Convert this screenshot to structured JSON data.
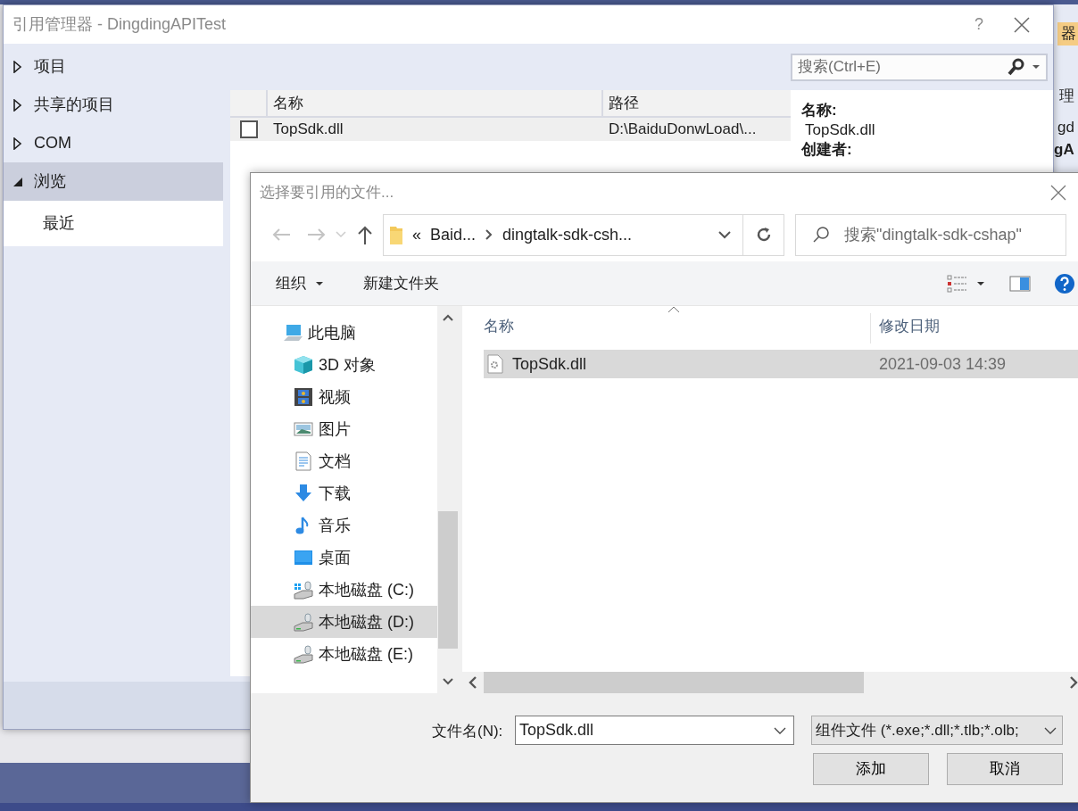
{
  "background_ide": {
    "fragments": [
      "器",
      "理",
      "gd",
      "gA"
    ]
  },
  "reference_manager": {
    "title": "引用管理器 - DingdingAPITest",
    "help": "?",
    "nav": [
      {
        "label": "项目",
        "expanded": false,
        "selected": false
      },
      {
        "label": "共享的项目",
        "expanded": false,
        "selected": false
      },
      {
        "label": "COM",
        "expanded": false,
        "selected": false
      },
      {
        "label": "浏览",
        "expanded": true,
        "selected": true,
        "children": [
          {
            "label": "最近",
            "selected": false
          }
        ]
      }
    ],
    "search": {
      "placeholder": "搜索(Ctrl+E)"
    },
    "table": {
      "columns": [
        "名称",
        "路径"
      ],
      "rows": [
        {
          "checked": false,
          "name": "TopSdk.dll",
          "path": "D:\\BaiduDonwLoad\\..."
        }
      ]
    },
    "details": [
      {
        "label": "名称:",
        "value": "TopSdk.dll"
      },
      {
        "label": "创建者:"
      }
    ]
  },
  "file_dialog": {
    "title": "选择要引用的文件...",
    "overflow": "«",
    "breadcrumb": [
      "Baid...",
      "dingtalk-sdk-csh..."
    ],
    "search": {
      "placeholder": "搜索\"dingtalk-sdk-cshap\""
    },
    "toolbar": [
      {
        "label": "组织",
        "menu": true
      },
      {
        "label": "新建文件夹",
        "menu": false
      }
    ],
    "nav": [
      {
        "label": "此电脑",
        "kind": "pc",
        "selected": false,
        "children": [
          {
            "label": "3D 对象",
            "kind": "cube",
            "selected": false
          },
          {
            "label": "视频",
            "kind": "video",
            "selected": false
          },
          {
            "label": "图片",
            "kind": "pictures",
            "selected": false
          },
          {
            "label": "文档",
            "kind": "documents",
            "selected": false
          },
          {
            "label": "下载",
            "kind": "downloads",
            "selected": false
          },
          {
            "label": "音乐",
            "kind": "music",
            "selected": false
          },
          {
            "label": "桌面",
            "kind": "desktop",
            "selected": false
          },
          {
            "label": "本地磁盘 (C:)",
            "kind": "system-drive",
            "selected": false
          },
          {
            "label": "本地磁盘 (D:)",
            "kind": "drive",
            "selected": true
          },
          {
            "label": "本地磁盘 (E:)",
            "kind": "drive",
            "selected": false
          }
        ]
      }
    ],
    "columns": [
      "名称",
      "修改日期"
    ],
    "files": [
      {
        "name": "TopSdk.dll",
        "modified": "2021-09-03 14:39",
        "selected": true
      }
    ],
    "filename_label": "文件名(N):",
    "filename": "TopSdk.dll",
    "filetype": "组件文件 (*.exe;*.dll;*.tlb;*.olb;",
    "buttons": [
      "添加",
      "取消"
    ]
  }
}
